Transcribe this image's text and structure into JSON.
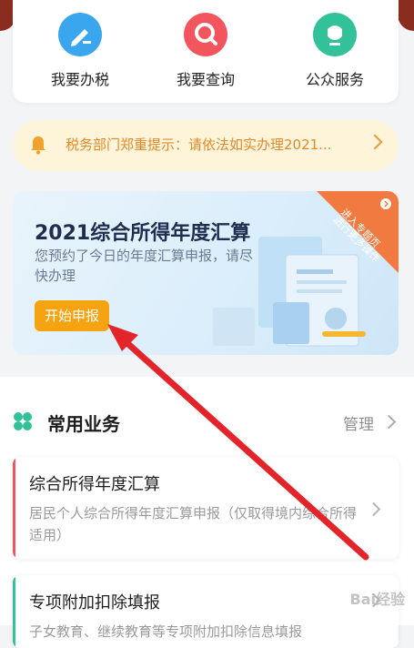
{
  "quick_actions": [
    {
      "label": "我要办税",
      "icon": "pen-icon",
      "color": "#3aa6ee"
    },
    {
      "label": "我要查询",
      "icon": "search-icon",
      "color": "#f2555d"
    },
    {
      "label": "公众服务",
      "icon": "leaf-icon",
      "color": "#33c19a"
    }
  ],
  "notice": {
    "text": "税务部门郑重提示：请依法如实办理2021..."
  },
  "banner": {
    "title": "2021综合所得年度汇算",
    "subtitle": "您预约了今日的年度汇算申报，请尽快办理",
    "button": "开始申报",
    "ribbon_line1": "进入专题页",
    "ribbon_line2": "进行更多操作"
  },
  "section": {
    "title": "常用业务",
    "manage": "管理"
  },
  "services": [
    {
      "title": "综合所得年度汇算",
      "desc": "居民个人综合所得年度汇算申报（仅取得境内综合所得适用）",
      "color": "#f2555d"
    },
    {
      "title": "专项附加扣除填报",
      "desc": "子女教育、继续教育等专项附加扣除信息填报",
      "color": "#33c19a"
    }
  ],
  "watermark": "Bai经验"
}
